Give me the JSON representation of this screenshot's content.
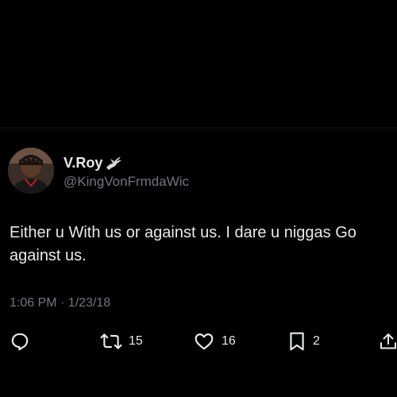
{
  "tweet": {
    "display_name": "V.Roy",
    "handle": "@KingVonFrmdaWic",
    "text": "Either u With us or against us. I dare u niggas Go against us.",
    "timestamp": "1:06 PM · 1/23/18",
    "icons": {
      "name_emoji": "bird-icon",
      "reply": "reply-icon",
      "retweet": "retweet-icon",
      "like": "heart-icon",
      "bookmark": "bookmark-icon",
      "share": "share-icon"
    },
    "actions": {
      "retweets": "15",
      "likes": "16",
      "bookmarks": "2"
    }
  },
  "colors": {
    "background": "#000000",
    "primary_text": "#e7e9ea",
    "secondary_text": "#71767b"
  }
}
